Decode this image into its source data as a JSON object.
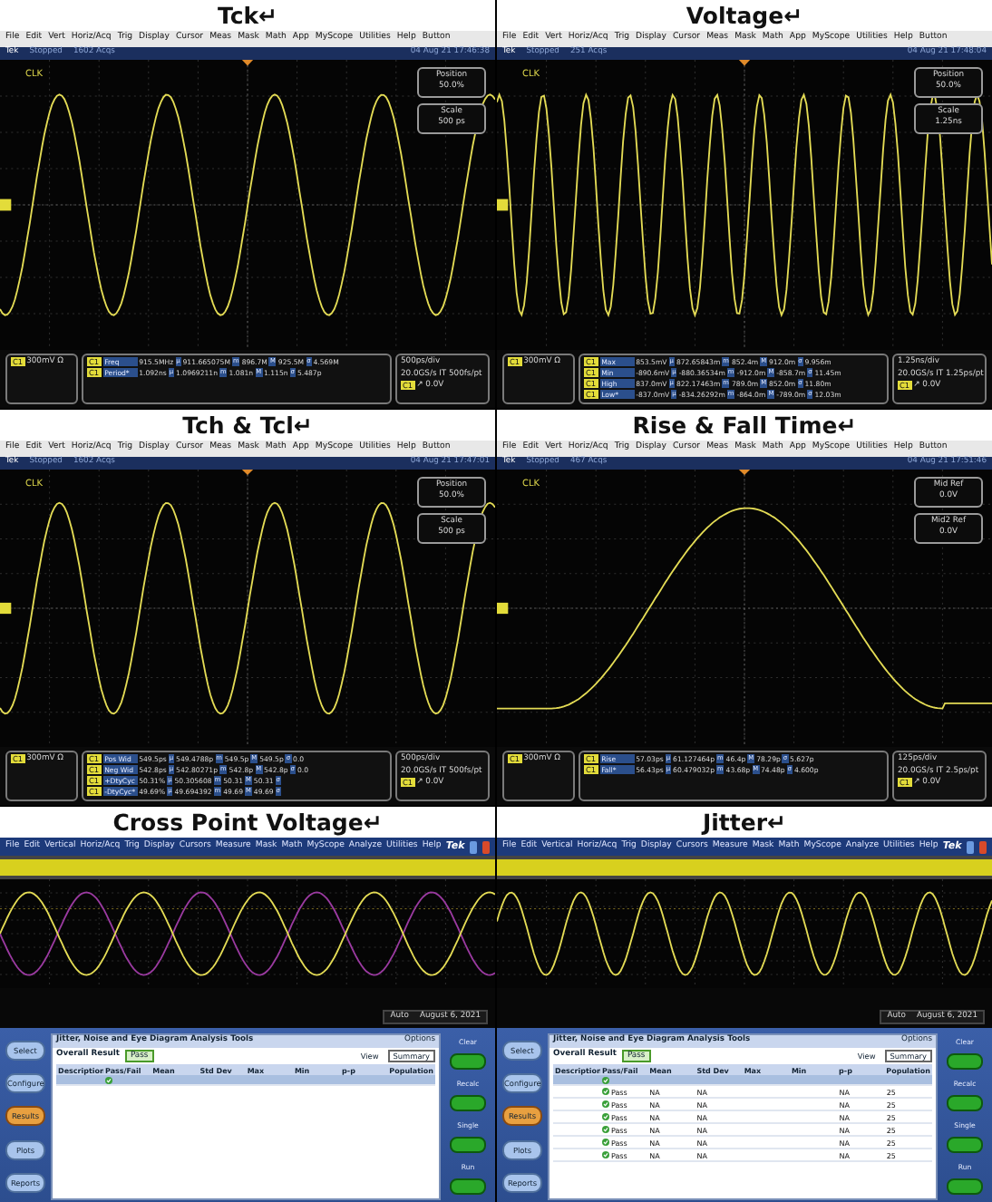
{
  "panels": [
    {
      "kind": "scope",
      "title": "Tck↵",
      "menu": [
        "File",
        "Edit",
        "Vert",
        "Horiz/Acq",
        "Trig",
        "Display",
        "Cursor",
        "Meas",
        "Mask",
        "Math",
        "App",
        "MyScope",
        "Utilities",
        "Help",
        "Button"
      ],
      "status": {
        "logo": "Tek",
        "state": "Stopped",
        "acqs": "1602 Acqs",
        "time": "04 Aug 21 17:46:38"
      },
      "trace_label": "CLK",
      "trace": {
        "kind": "sine-slow"
      },
      "side_boxes": [
        {
          "label": "Position",
          "value": "50.0%"
        },
        {
          "label": "Scale",
          "value": "500 ps"
        }
      ],
      "channel": {
        "tag": "C1",
        "scale": "300mV Ω"
      },
      "measurements": [
        {
          "tag": "C1",
          "name": "Freq",
          "cells": [
            "915.5MHz",
            "μ",
            "911.665075M",
            "m",
            "896.7M",
            "M",
            "925.5M",
            "σ",
            "4.569M"
          ]
        },
        {
          "tag": "C1",
          "name": "Period*",
          "cells": [
            "1.092ns",
            "μ",
            "1.0969211n",
            "m",
            "1.081n",
            "M",
            "1.115n",
            "σ",
            "5.487p"
          ]
        }
      ],
      "timebase": [
        "500ps/div",
        "20.0GS/s IT 500fs/pt"
      ],
      "trigger": {
        "tag": "C1",
        "level": "↗ 0.0V"
      }
    },
    {
      "kind": "scope",
      "title": "Voltage↵",
      "menu": [
        "File",
        "Edit",
        "Vert",
        "Horiz/Acq",
        "Trig",
        "Display",
        "Cursor",
        "Meas",
        "Mask",
        "Math",
        "App",
        "MyScope",
        "Utilities",
        "Help",
        "Button"
      ],
      "status": {
        "logo": "Tek",
        "state": "Stopped",
        "acqs": "251 Acqs",
        "time": "04 Aug 21 17:48:04"
      },
      "trace_label": "CLK",
      "trace": {
        "kind": "sine-fast"
      },
      "side_boxes": [
        {
          "label": "Position",
          "value": "50.0%"
        },
        {
          "label": "Scale",
          "value": "1.25ns"
        }
      ],
      "channel": {
        "tag": "C1",
        "scale": "300mV Ω"
      },
      "measurements": [
        {
          "tag": "C1",
          "name": "Max",
          "cells": [
            "853.5mV",
            "μ",
            "872.65843m",
            "m",
            "852.4m",
            "M",
            "912.0m",
            "σ",
            "9.956m"
          ]
        },
        {
          "tag": "C1",
          "name": "Min",
          "cells": [
            "-890.6mV",
            "μ",
            "-880.36534m",
            "m",
            "-912.0m",
            "M",
            "-858.7m",
            "σ",
            "11.45m"
          ]
        },
        {
          "tag": "C1",
          "name": "High",
          "cells": [
            "837.0mV",
            "μ",
            "822.17463m",
            "m",
            "789.0m",
            "M",
            "852.0m",
            "σ",
            "11.80m"
          ]
        },
        {
          "tag": "C1",
          "name": "Low*",
          "cells": [
            "-837.0mV",
            "μ",
            "-834.26292m",
            "m",
            "-864.0m",
            "M",
            "-789.0m",
            "σ",
            "12.03m"
          ]
        }
      ],
      "timebase": [
        "1.25ns/div",
        "20.0GS/s IT 1.25ps/pt"
      ],
      "trigger": {
        "tag": "C1",
        "level": "↗ 0.0V"
      }
    },
    {
      "kind": "scope",
      "title": "Tch & Tcl↵",
      "menu": [
        "File",
        "Edit",
        "Vert",
        "Horiz/Acq",
        "Trig",
        "Display",
        "Cursor",
        "Meas",
        "Mask",
        "Math",
        "App",
        "MyScope",
        "Utilities",
        "Help",
        "Button"
      ],
      "status": {
        "logo": "Tek",
        "state": "Stopped",
        "acqs": "1602 Acqs",
        "time": "04 Aug 21 17:47:01"
      },
      "trace_label": "CLK",
      "trace": {
        "kind": "sine-slow"
      },
      "side_boxes": [
        {
          "label": "Position",
          "value": "50.0%"
        },
        {
          "label": "Scale",
          "value": "500 ps"
        }
      ],
      "channel": {
        "tag": "C1",
        "scale": "300mV Ω"
      },
      "measurements": [
        {
          "tag": "C1",
          "name": "Pos Wid",
          "cells": [
            "549.5ps",
            "μ",
            "549.4788p",
            "m",
            "549.5p",
            "M",
            "549.5p",
            "σ",
            "0.0"
          ]
        },
        {
          "tag": "C1",
          "name": "Neg Wid",
          "cells": [
            "542.8ps",
            "μ",
            "542.80271p",
            "m",
            "542.8p",
            "M",
            "542.8p",
            "σ",
            "0.0"
          ]
        },
        {
          "tag": "C1",
          "name": "+DtyCyc",
          "cells": [
            "50.31%",
            "μ",
            "50.305608",
            "m",
            "50.31",
            "M",
            "50.31",
            "σ"
          ]
        },
        {
          "tag": "C1",
          "name": "-DtyCyc*",
          "cells": [
            "49.69%",
            "μ",
            "49.694392",
            "m",
            "49.69",
            "M",
            "49.69",
            "σ"
          ]
        }
      ],
      "timebase": [
        "500ps/div",
        "20.0GS/s IT 500fs/pt"
      ],
      "trigger": {
        "tag": "C1",
        "level": "↗ 0.0V"
      }
    },
    {
      "kind": "scope",
      "title": "Rise & Fall Time↵",
      "menu": [
        "File",
        "Edit",
        "Vert",
        "Horiz/Acq",
        "Trig",
        "Display",
        "Cursor",
        "Meas",
        "Mask",
        "Math",
        "App",
        "MyScope",
        "Utilities",
        "Help",
        "Button"
      ],
      "status": {
        "logo": "Tek",
        "state": "Stopped",
        "acqs": "467 Acqs",
        "time": "04 Aug 21 17:51:46"
      },
      "trace_label": "CLK",
      "trace": {
        "kind": "edge"
      },
      "side_boxes": [
        {
          "label": "Mid Ref",
          "value": "0.0V"
        },
        {
          "label": "Mid2 Ref",
          "value": "0.0V"
        }
      ],
      "channel": {
        "tag": "C1",
        "scale": "300mV Ω"
      },
      "measurements": [
        {
          "tag": "C1",
          "name": "Rise",
          "cells": [
            "57.03ps",
            "μ",
            "61.127464p",
            "m",
            "46.4p",
            "M",
            "78.29p",
            "σ",
            "5.627p"
          ]
        },
        {
          "tag": "C1",
          "name": "Fall*",
          "cells": [
            "56.43ps",
            "μ",
            "60.479032p",
            "m",
            "43.68p",
            "M",
            "74.48p",
            "σ",
            "4.600p"
          ]
        }
      ],
      "timebase": [
        "125ps/div",
        "20.0GS/s IT 2.5ps/pt"
      ],
      "trigger": {
        "tag": "C1",
        "level": "↗ 0.0V"
      }
    },
    {
      "kind": "jitter",
      "title": "Cross Point Voltage↵",
      "menu": [
        "File",
        "Edit",
        "Vertical",
        "Horiz/Acq",
        "Trig",
        "Display",
        "Cursors",
        "Measure",
        "Mask",
        "Math",
        "MyScope",
        "Analyze",
        "Utilities",
        "Help"
      ],
      "logo": "Tek",
      "trace": {
        "kind": "cross"
      },
      "acq": {
        "mode": "Auto",
        "date": "August 6, 2021"
      },
      "tool": {
        "title": "Jitter, Noise and Eye Diagram Analysis Tools",
        "options": "Options",
        "overall": "Overall Result",
        "result": "Pass",
        "view_label": "View",
        "view": "Summary",
        "nav": [
          {
            "label": "Select",
            "selected": false
          },
          {
            "label": "Configure",
            "selected": false
          },
          {
            "label": "Results",
            "selected": true
          },
          {
            "label": "Plots",
            "selected": false
          },
          {
            "label": "Reports",
            "selected": false
          }
        ],
        "actions": [
          "Clear",
          "Recalc",
          "Single",
          "Run"
        ],
        "columns": [
          "Description",
          "Pass/Fail",
          "Mean",
          "Std Dev",
          "Max",
          "Min",
          "p-p",
          "Population"
        ],
        "rows": [
          {
            "selected": true,
            "passed": true
          }
        ]
      }
    },
    {
      "kind": "jitter",
      "title": "Jitter↵",
      "menu": [
        "File",
        "Edit",
        "Vertical",
        "Horiz/Acq",
        "Trig",
        "Display",
        "Cursors",
        "Measure",
        "Mask",
        "Math",
        "MyScope",
        "Analyze",
        "Utilities",
        "Help"
      ],
      "logo": "Tek",
      "trace": {
        "kind": "jitter"
      },
      "acq": {
        "mode": "Auto",
        "date": "August 6, 2021"
      },
      "tool": {
        "title": "Jitter, Noise and Eye Diagram Analysis Tools",
        "options": "Options",
        "overall": "Overall Result",
        "result": "Pass",
        "view_label": "View",
        "view": "Summary",
        "nav": [
          {
            "label": "Select",
            "selected": false
          },
          {
            "label": "Configure",
            "selected": false
          },
          {
            "label": "Results",
            "selected": true
          },
          {
            "label": "Plots",
            "selected": false
          },
          {
            "label": "Reports",
            "selected": false
          }
        ],
        "actions": [
          "Clear",
          "Recalc",
          "Single",
          "Run"
        ],
        "columns": [
          "Description",
          "Pass/Fail",
          "Mean",
          "Std Dev",
          "Max",
          "Min",
          "p-p",
          "Population"
        ],
        "rows": [
          {
            "selected": true,
            "passed": true
          },
          {
            "selected": false,
            "passed": true,
            "cells": [
              "Pass",
              "NA",
              "NA",
              "",
              "",
              "NA",
              "25"
            ]
          },
          {
            "selected": false,
            "passed": true,
            "cells": [
              "Pass",
              "NA",
              "NA",
              "",
              "",
              "NA",
              "25"
            ]
          },
          {
            "selected": false,
            "passed": true,
            "cells": [
              "Pass",
              "NA",
              "NA",
              "",
              "",
              "NA",
              "25"
            ]
          },
          {
            "selected": false,
            "passed": true,
            "cells": [
              "Pass",
              "NA",
              "NA",
              "",
              "",
              "NA",
              "25"
            ]
          },
          {
            "selected": false,
            "passed": true,
            "cells": [
              "Pass",
              "NA",
              "NA",
              "",
              "",
              "NA",
              "25"
            ]
          },
          {
            "selected": false,
            "passed": true,
            "cells": [
              "Pass",
              "NA",
              "NA",
              "",
              "",
              "NA",
              "25"
            ]
          }
        ]
      }
    }
  ]
}
